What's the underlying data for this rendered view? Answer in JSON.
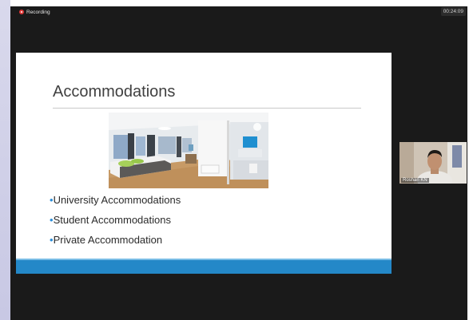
{
  "recording": {
    "label": "Recording"
  },
  "timer": {
    "value": "00:24:09"
  },
  "slide": {
    "title": "Accommodations",
    "photo_icon": "room-photo",
    "bullet_char": "•",
    "bullets": [
      "University Accommodations",
      "Student Accommodations",
      "Private Accommodation"
    ],
    "accent_color": "#2488c8"
  },
  "participant": {
    "name": "Roshan KN"
  }
}
